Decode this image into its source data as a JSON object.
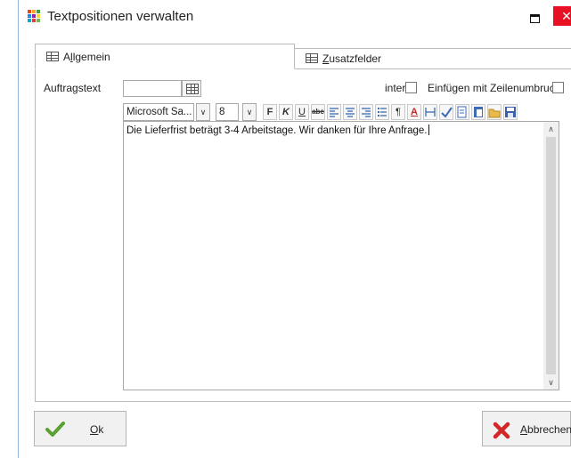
{
  "window": {
    "title": "Textpositionen verwalten",
    "close_glyph": "✕"
  },
  "tabs": [
    {
      "label_prefix": "A",
      "label_underlined": "l",
      "label_rest": "lgemein",
      "icon": "table-icon",
      "active": true
    },
    {
      "label_prefix": "",
      "label_underlined": "Z",
      "label_rest": "usatzfelder",
      "icon": "form-icon",
      "active": false
    }
  ],
  "fields": {
    "auftragstext_label": "Auftragstext",
    "date_value": "",
    "intern_label": "intern",
    "intern_checked": false,
    "einfuegen_label": "Einfügen mit Zeilenumbruch",
    "einfuegen_checked": false
  },
  "toolbar": {
    "font_family": "Microsoft Sa...",
    "font_size": "8",
    "bold_label": "F",
    "italic_label": "K",
    "underline_label": "U",
    "strike_label": "abc",
    "paragraph_label": "¶",
    "color_label": "A",
    "dropdown_glyph": "∨"
  },
  "editor": {
    "text": "Die Lieferfrist beträgt 3-4 Arbeitstage. Wir danken für Ihre Anfrage."
  },
  "buttons": {
    "ok_prefix": "",
    "ok_underlined": "O",
    "ok_rest": "k",
    "cancel_prefix": "",
    "cancel_underlined": "A",
    "cancel_rest": "bbrechen"
  },
  "colors": {
    "close_red": "#e81123",
    "ok_green": "#5aa032",
    "cancel_red": "#d22828",
    "window_border": "#8fb4da"
  }
}
